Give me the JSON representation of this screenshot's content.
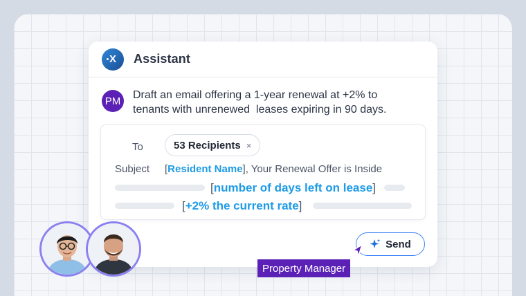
{
  "assistant": {
    "title": "Assistant",
    "logo_icon": "assistant-logo-icon",
    "logo_glyph": "X"
  },
  "prompt": {
    "avatar_initials": "PM",
    "text": "Draft an email offering a 1-year renewal at +2% to tenants with unrenewed  leases expiring in 90 days."
  },
  "email": {
    "to_label": "To",
    "recipients_chip": "53 Recipients",
    "chip_remove": "×",
    "subject_label": "Subject",
    "subject_token": "Resident Name",
    "subject_rest": ", Your Renewal Offer is Inside",
    "body_token_1": "number of days left on lease",
    "body_token_2": "+2% the current rate",
    "bracket_open": "[",
    "bracket_close": "]"
  },
  "send_button": {
    "label": "Send",
    "icon": "sparkle-icon"
  },
  "cursor_tag": {
    "label": "Property Manager"
  },
  "colors": {
    "accent_blue": "#1e9be6",
    "purple": "#5b21b6",
    "ring": "#8b80f0"
  }
}
